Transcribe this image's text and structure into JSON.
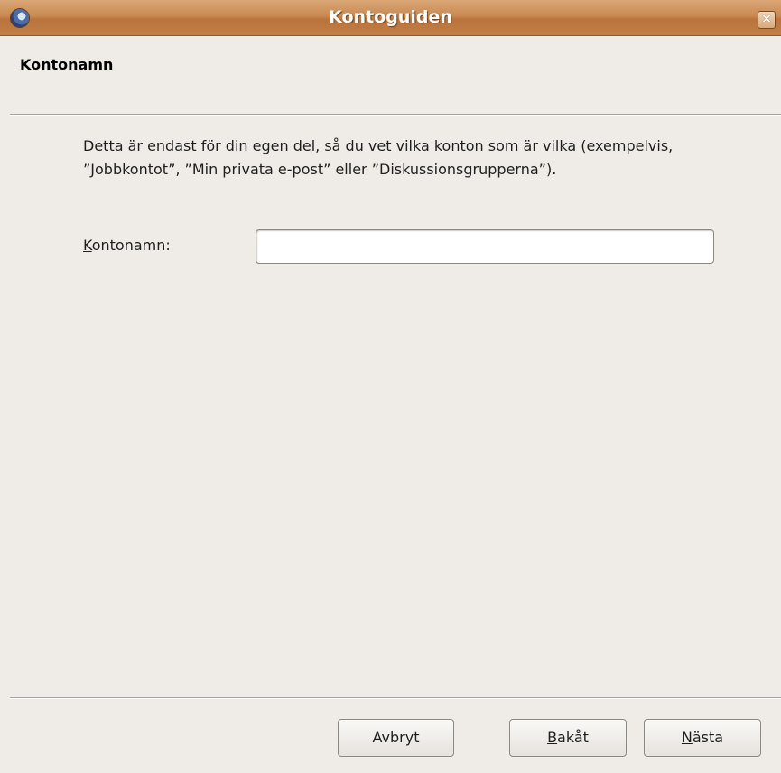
{
  "window": {
    "title": "Kontoguiden",
    "app_icon": "thunderbird-app-icon",
    "close_glyph": "×"
  },
  "header": {
    "heading": "Kontonamn"
  },
  "main": {
    "description": "Detta är endast för din egen del, så du vet vilka konton som är vilka (exempelvis, ”Jobbkontot”, ”Min privata e-post” eller ”Diskussionsgrupperna”).",
    "field": {
      "label_mnemonic": "K",
      "label_rest": "ontonamn:",
      "value": "",
      "placeholder": ""
    }
  },
  "footer": {
    "cancel_label": "Avbryt",
    "back_mnemonic": "B",
    "back_rest": "akåt",
    "next_mnemonic": "N",
    "next_rest": "ästa"
  },
  "colors": {
    "titlebar": "#c98a52",
    "background": "#efebe7"
  }
}
